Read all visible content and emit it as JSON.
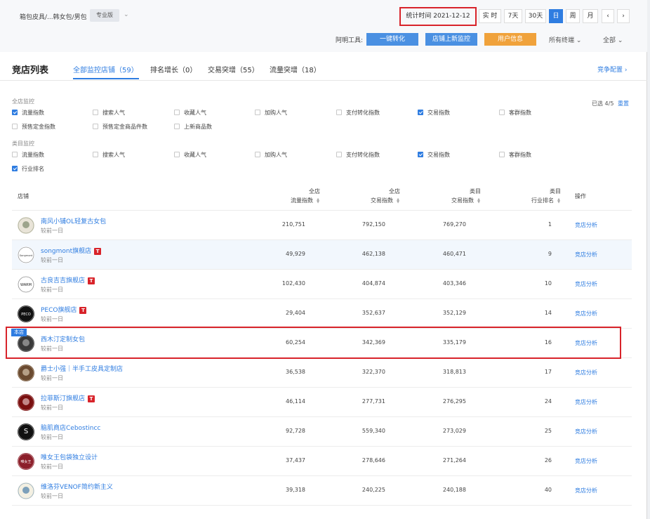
{
  "topbar": {
    "breadcrumb": "箱包皮具/...韩女包/男包",
    "edition_badge": "专业版",
    "stat_time": "统计时间 2021-12-12",
    "periods": [
      {
        "label": "实 时",
        "active": false
      },
      {
        "label": "7天",
        "active": false
      },
      {
        "label": "30天",
        "active": false
      },
      {
        "label": "日",
        "active": true
      },
      {
        "label": "周",
        "active": false
      },
      {
        "label": "月",
        "active": false
      }
    ],
    "prev_glyph": "‹",
    "next_glyph": "›",
    "tools_label": "阿明工具:",
    "tool_buttons": [
      {
        "label": "一键转化",
        "color": "#4a90e2"
      },
      {
        "label": "店铺上新监控",
        "color": "#4a90e2"
      },
      {
        "label": "用户信息",
        "color": "#f0a23b"
      }
    ],
    "terminal_select": "所有终端 ⌄",
    "scope_select": "全部 ⌄"
  },
  "header": {
    "title": "竞店列表",
    "tabs": [
      {
        "label": "全部监控店铺（59）",
        "active": true
      },
      {
        "label": "排名增长（0）",
        "active": false
      },
      {
        "label": "交易突增（55）",
        "active": false
      },
      {
        "label": "流量突增（18）",
        "active": false
      }
    ],
    "config_link": "竞争配置 ›"
  },
  "filters": {
    "shop_section_label": "全店监控",
    "shop_options": [
      {
        "label": "流量指数",
        "checked": true
      },
      {
        "label": "搜索人气",
        "checked": false
      },
      {
        "label": "收藏人气",
        "checked": false
      },
      {
        "label": "加购人气",
        "checked": false
      },
      {
        "label": "支付转化指数",
        "checked": false
      },
      {
        "label": "交易指数",
        "checked": true
      },
      {
        "label": "客群指数",
        "checked": false
      },
      {
        "label": "预售定金指数",
        "checked": false
      },
      {
        "label": "预售定金商品件数",
        "checked": false
      },
      {
        "label": "上新商品数",
        "checked": false
      }
    ],
    "cat_section_label": "类目监控",
    "cat_options": [
      {
        "label": "流量指数",
        "checked": false
      },
      {
        "label": "搜索人气",
        "checked": false
      },
      {
        "label": "收藏人气",
        "checked": false
      },
      {
        "label": "加购人气",
        "checked": false
      },
      {
        "label": "支付转化指数",
        "checked": false
      },
      {
        "label": "交易指数",
        "checked": true
      },
      {
        "label": "客群指数",
        "checked": false
      },
      {
        "label": "行业排名",
        "checked": true
      }
    ],
    "selected_info": "已选 4/5",
    "reset": "重置"
  },
  "table": {
    "col_shop": "店铺",
    "col_traffic": [
      "全店",
      "流量指数"
    ],
    "col_trade": [
      "全店",
      "交易指数"
    ],
    "col_cat_trade": [
      "类目",
      "交易指数"
    ],
    "col_cat_rank": [
      "类目",
      "行业排名"
    ],
    "col_op": "操作",
    "own_tag": "本店",
    "rows": [
      {
        "name": "南风小铺OL轻复古女包",
        "tmall": false,
        "sub": "较前一日",
        "traffic": "210,751",
        "trade": "792,150",
        "cat_trade": "769,270",
        "rank": "1",
        "op": "竞店分析",
        "avatar_bg": "#e9e4d8",
        "avatar_fg": "#6b7a5a",
        "avatar_text": "",
        "hl": false
      },
      {
        "name": "songmont旗舰店",
        "tmall": true,
        "sub": "较前一日",
        "traffic": "49,929",
        "trade": "462,138",
        "cat_trade": "460,471",
        "rank": "9",
        "op": "竞店分析",
        "avatar_bg": "#ffffff",
        "avatar_fg": "#333333",
        "avatar_text": "Songmont",
        "hl": true
      },
      {
        "name": "古良吉吉旗舰店",
        "tmall": true,
        "sub": "较前一日",
        "traffic": "102,430",
        "trade": "404,874",
        "cat_trade": "403,346",
        "rank": "10",
        "op": "竞店分析",
        "avatar_bg": "#ffffff",
        "avatar_fg": "#222222",
        "avatar_text": "WARM",
        "hl": false
      },
      {
        "name": "PECO旗舰店",
        "tmall": true,
        "sub": "较前一日",
        "traffic": "29,404",
        "trade": "352,637",
        "cat_trade": "352,129",
        "rank": "14",
        "op": "竞店分析",
        "avatar_bg": "#111111",
        "avatar_fg": "#ffffff",
        "avatar_text": "PECO",
        "hl": false
      },
      {
        "name": "西木汀定制女包",
        "tmall": false,
        "sub": "较前一日",
        "traffic": "60,254",
        "trade": "342,369",
        "cat_trade": "335,179",
        "rank": "16",
        "op": "竞店分析",
        "avatar_bg": "#3a3a3a",
        "avatar_fg": "#bbbbbb",
        "avatar_text": "",
        "hl": false
      },
      {
        "name": "爵士小强｜半手工皮具定制店",
        "tmall": false,
        "sub": "较前一日",
        "traffic": "36,538",
        "trade": "322,370",
        "cat_trade": "318,813",
        "rank": "17",
        "op": "竞店分析",
        "avatar_bg": "#6a4a30",
        "avatar_fg": "#e8d9c0",
        "avatar_text": "",
        "hl": false
      },
      {
        "name": "拉菲斯汀旗舰店",
        "tmall": true,
        "sub": "较前一日",
        "traffic": "46,114",
        "trade": "277,731",
        "cat_trade": "276,295",
        "rank": "24",
        "op": "竞店分析",
        "avatar_bg": "#7a1010",
        "avatar_fg": "#f2d7d7",
        "avatar_text": "",
        "hl": false
      },
      {
        "name": "脑肌商店Cebostincc",
        "tmall": false,
        "sub": "较前一日",
        "traffic": "92,728",
        "trade": "559,340",
        "cat_trade": "273,029",
        "rank": "25",
        "op": "竞店分析",
        "avatar_bg": "#111111",
        "avatar_fg": "#ffffff",
        "avatar_text": "S",
        "hl": false
      },
      {
        "name": "唯女王包袋独立设计",
        "tmall": false,
        "sub": "较前一日",
        "traffic": "37,437",
        "trade": "278,646",
        "cat_trade": "271,264",
        "rank": "26",
        "op": "竞店分析",
        "avatar_bg": "#8c1f2a",
        "avatar_fg": "#ffffff",
        "avatar_text": "唯女王",
        "hl": false
      },
      {
        "name": "维洛芬VENOF简约新主义",
        "tmall": false,
        "sub": "较前一日",
        "traffic": "39,318",
        "trade": "240,225",
        "cat_trade": "240,188",
        "rank": "40",
        "op": "竞店分析",
        "avatar_bg": "#f4f0e2",
        "avatar_fg": "#2d6aa0",
        "avatar_text": "",
        "hl": false
      }
    ]
  }
}
